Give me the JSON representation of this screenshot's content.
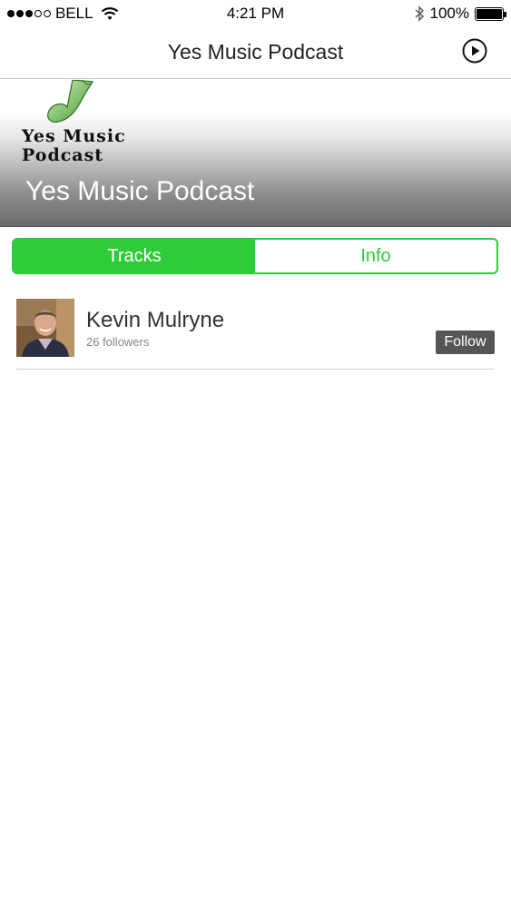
{
  "status_bar": {
    "carrier": "BELL",
    "time": "4:21 PM",
    "battery": "100%",
    "signal_bars_filled": 3,
    "signal_bars_total": 5
  },
  "nav": {
    "title": "Yes Music Podcast",
    "play_icon": "play-circle-icon"
  },
  "banner": {
    "logo_line1": "Yes Music",
    "logo_line2": "Podcast",
    "title": "Yes Music Podcast"
  },
  "tabs": [
    {
      "label": "Tracks",
      "active": true
    },
    {
      "label": "Info",
      "active": false
    }
  ],
  "artist": {
    "name": "Kevin Mulryne",
    "followers": "26 followers",
    "follow_label": "Follow"
  },
  "colors": {
    "accent": "#2fcc3a",
    "follow_button": "#555555"
  }
}
